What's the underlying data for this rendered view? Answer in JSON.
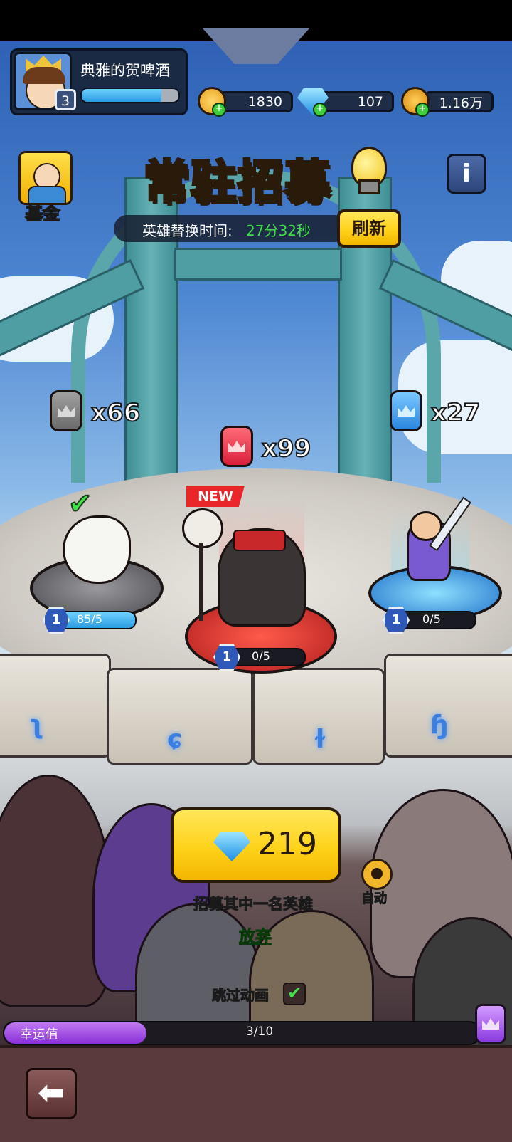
{
  "player": {
    "name": "典雅的贺啤酒",
    "level": "3",
    "exp_progress": 0.82
  },
  "resources": [
    {
      "icon": "smiley-coin-icon",
      "value": "1830",
      "color": "#f2b632"
    },
    {
      "icon": "diamond-icon",
      "value": "107",
      "color": "#2fa8ff"
    },
    {
      "icon": "gold-coin-icon",
      "value": "1.16万",
      "color": "#f0a521"
    }
  ],
  "fund": {
    "label": "基金",
    "icon": "king-portrait-icon"
  },
  "title": "常驻招募",
  "hint_icon": "lightbulb-icon",
  "info_icon": "info-icon",
  "refresh_timer": {
    "label": "英雄替换时间:",
    "time": "27分32秒",
    "button": "刷新"
  },
  "tokens": [
    {
      "name": "gray",
      "count": "x66",
      "color": "#8a8a8a"
    },
    {
      "name": "red",
      "count": "x99",
      "color": "#e83a4a"
    },
    {
      "name": "blue",
      "count": "x27",
      "color": "#3aa0f0"
    }
  ],
  "heroes": [
    {
      "id": "white-bird-hero",
      "level": "1",
      "progress_text": "85/5",
      "fill": 1.0,
      "selected": true
    },
    {
      "id": "dark-shaman-hero",
      "level": "1",
      "progress_text": "0/5",
      "fill": 0.0,
      "new_tag": "NEW"
    },
    {
      "id": "sword-warrior-hero",
      "level": "1",
      "progress_text": "0/5",
      "fill": 0.0
    }
  ],
  "recruit": {
    "cost": "219",
    "caption": "招募其中一名英雄",
    "auto_label": "自动",
    "abandon": "放弃"
  },
  "skip_animation": {
    "label": "跳过动画",
    "checked": true
  },
  "luck": {
    "label": "幸运值",
    "value_text": "3/10",
    "fill": 0.3
  },
  "colors": {
    "accent_yellow": "#ffd21a",
    "green_text": "#3fe04a",
    "luck_purple": "#9b3fe0",
    "panel_bg": "#5a3a3a"
  }
}
